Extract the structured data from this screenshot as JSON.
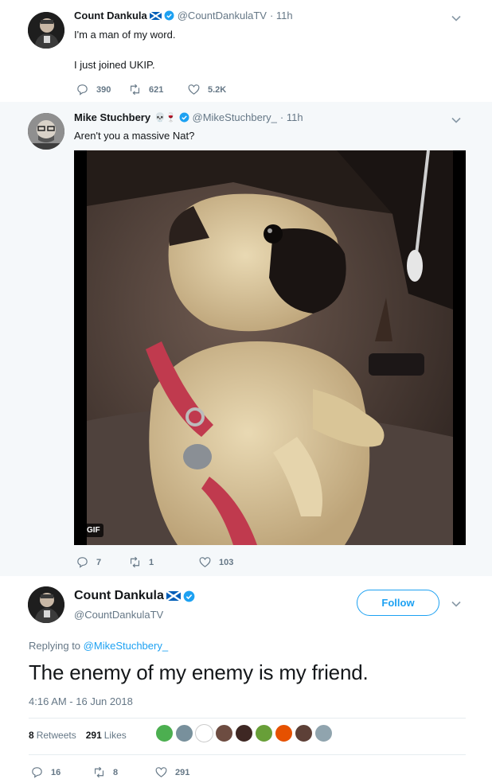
{
  "tweet1": {
    "name": "Count Dankula",
    "handle": "@CountDankulaTV",
    "time": "· 11h",
    "lines": [
      "I'm a man of my word.",
      "I just joined UKIP."
    ],
    "counts": {
      "replies": "390",
      "retweets": "621",
      "likes": "5.2K"
    }
  },
  "tweet2": {
    "name": "Mike Stuchbery",
    "emojis": "💀🍷",
    "handle": "@MikeStuchbery_",
    "time": "· 11h",
    "text": "Aren't you a massive Nat?",
    "media_badge": "GIF",
    "counts": {
      "replies": "7",
      "retweets": "1",
      "likes": "103"
    }
  },
  "focused": {
    "name": "Count Dankula",
    "handle": "@CountDankulaTV",
    "follow_label": "Follow",
    "replying_prefix": "Replying to",
    "replying_handle": "@MikeStuchbery_",
    "text": "The enemy of my enemy is my friend.",
    "timestamp": "4:16 AM - 16 Jun 2018",
    "retweets_count": "8",
    "retweets_label": "Retweets",
    "likes_count": "291",
    "likes_label": "Likes",
    "counts": {
      "replies": "16",
      "retweets": "8",
      "likes": "291"
    }
  },
  "colors": {
    "accent": "#1da1f2",
    "muted": "#657786",
    "thread_line": "#ccd6dd",
    "reply_bg": "#f5f8fa"
  },
  "icons": [
    "reply-icon",
    "retweet-icon",
    "like-icon",
    "verified-badge-icon",
    "scotland-flag-icon",
    "chevron-down-icon"
  ]
}
